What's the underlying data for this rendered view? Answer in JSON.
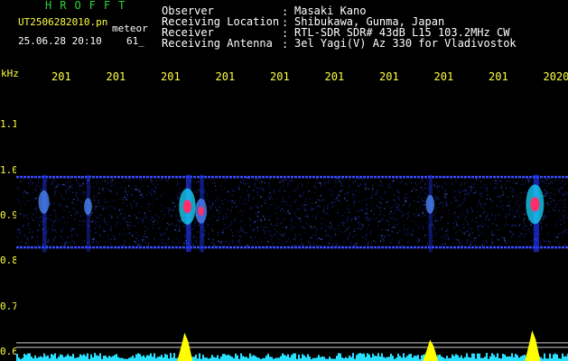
{
  "header": {
    "brand": "HROFFT",
    "filename": "UT2506282010.pn",
    "tag": "meteor",
    "datetime": "25.06.28 20:10",
    "sequence": "61_"
  },
  "meta": {
    "observer_label": "Observer",
    "observer_value": "Masaki Kano",
    "location_label": "Receiving Location",
    "location_value": "Shibukawa, Gunma, Japan",
    "receiver_label": "Receiver",
    "receiver_value": "RTL-SDR SDR# 43dB L15 103.2MHz CW",
    "antenna_label": "Receiving Antenna",
    "antenna_value": "3el Yagi(V) Az 330 for Vladivostok",
    "colon": ":"
  },
  "colors": {
    "background": "#000000",
    "label_yellow": "#ffff40",
    "brand_green": "#2fd23a",
    "carrier_blue": "#3a4cff",
    "echo_red": "#ff2d6a",
    "noise_floor": "#28e0ff",
    "spike_yellow": "#ffff00"
  },
  "chart_data": {
    "type": "heatmap",
    "ylabel": "kHz",
    "y_ticks": [
      "1.1",
      "1.0",
      "0.9",
      "0.8",
      "0.7",
      "0.6"
    ],
    "y_range": [
      0.58,
      1.18
    ],
    "x_ticks": [
      "201",
      "201",
      "201",
      "201",
      "201",
      "201",
      "201",
      "201",
      "201",
      "2020"
    ],
    "horizontal_lines_khz": [
      0.985,
      0.83
    ],
    "echoes": [
      {
        "x_frac": 0.05,
        "freq": 0.93,
        "strength": 0.5
      },
      {
        "x_frac": 0.13,
        "freq": 0.92,
        "strength": 0.3
      },
      {
        "x_frac": 0.31,
        "freq": 0.92,
        "strength": 0.9
      },
      {
        "x_frac": 0.335,
        "freq": 0.91,
        "strength": 0.55
      },
      {
        "x_frac": 0.75,
        "freq": 0.925,
        "strength": 0.35
      },
      {
        "x_frac": 0.94,
        "freq": 0.925,
        "strength": 1.0
      }
    ],
    "bottom_spikes": [
      {
        "x_frac": 0.305,
        "level": 0.9
      },
      {
        "x_frac": 0.75,
        "level": 0.6
      },
      {
        "x_frac": 0.935,
        "level": 1.0
      }
    ]
  }
}
